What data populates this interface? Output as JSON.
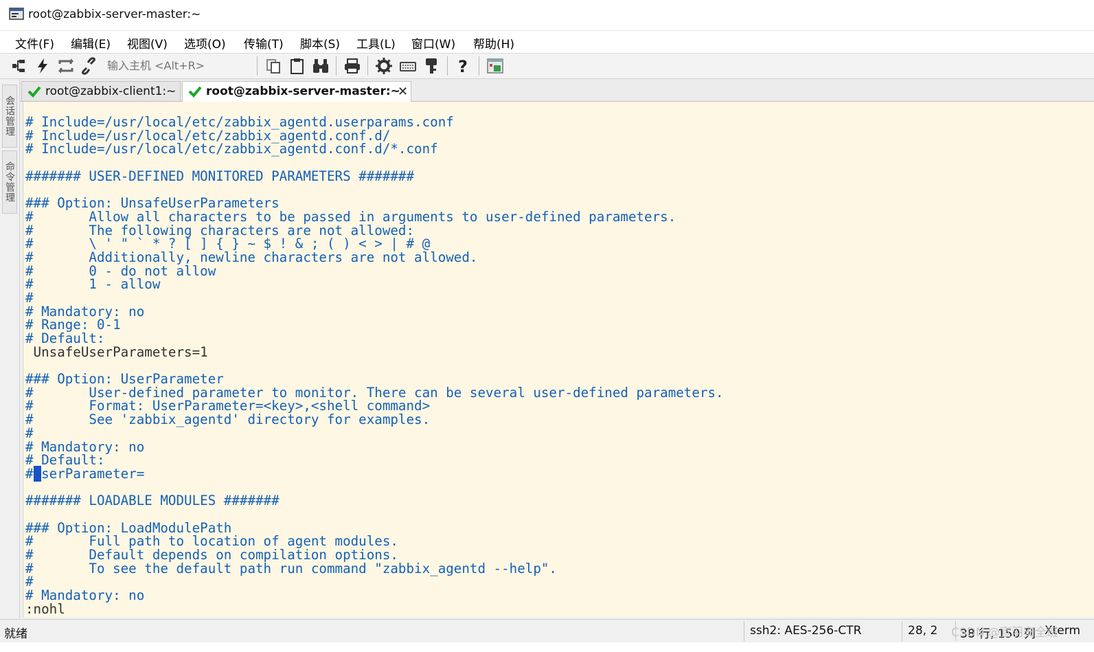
{
  "window": {
    "title": "root@zabbix-server-master:~"
  },
  "menu": [
    {
      "label": "文件(F)"
    },
    {
      "label": "编辑(E)"
    },
    {
      "label": "视图(V)"
    },
    {
      "label": "选项(O)"
    },
    {
      "label": "传输(T)"
    },
    {
      "label": "脚本(S)"
    },
    {
      "label": "工具(L)"
    },
    {
      "label": "窗口(W)"
    },
    {
      "label": "帮助(H)"
    }
  ],
  "toolbar": {
    "host_placeholder": "输入主机 <Alt+R>",
    "icons": [
      "connect-icon",
      "quick-connect-icon",
      "reconnect-icon",
      "disconnect-icon",
      "copy-icon",
      "paste-icon",
      "find-icon",
      "print-icon",
      "settings-icon",
      "keymap-icon",
      "key-icon",
      "help-icon",
      "sftp-icon"
    ]
  },
  "side_tabs": [
    {
      "label": "会话管理"
    },
    {
      "label": "命令管理"
    }
  ],
  "tabs": [
    {
      "label": "root@zabbix-client1:~",
      "active": false
    },
    {
      "label": "root@zabbix-server-master:~",
      "active": true,
      "close": "✕"
    }
  ],
  "terminal": {
    "lines": [
      "# Include=/usr/local/etc/zabbix_agentd.userparams.conf",
      "# Include=/usr/local/etc/zabbix_agentd.conf.d/",
      "# Include=/usr/local/etc/zabbix_agentd.conf.d/*.conf",
      "",
      "####### USER-DEFINED MONITORED PARAMETERS #######",
      "",
      "### Option: UnsafeUserParameters",
      "#       Allow all characters to be passed in arguments to user-defined parameters.",
      "#       The following characters are not allowed:",
      "#       \\ ' \" ` * ? [ ] { } ~ $ ! & ; ( ) < > | # @",
      "#       Additionally, newline characters are not allowed.",
      "#       0 - do not allow",
      "#       1 - allow",
      "#",
      "# Mandatory: no",
      "# Range: 0-1",
      "# Default:",
      " UnsafeUserParameters=1",
      "",
      "### Option: UserParameter",
      "#       User-defined parameter to monitor. There can be several user-defined parameters.",
      "#       Format: UserParameter=<key>,<shell command>",
      "#       See 'zabbix_agentd' directory for examples.",
      "#",
      "# Mandatory: no",
      "# Default:",
      "#",
      "",
      "####### LOADABLE MODULES #######",
      "",
      "### Option: LoadModulePath",
      "#       Full path to location of agent modules.",
      "#       Default depends on compilation options.",
      "#       To see the default path run command \"zabbix_agentd --help\".",
      "#",
      "# Mandatory: no",
      ":nohl"
    ],
    "cursor_line_prefix": "#",
    "cursor_char": "U",
    "cursor_line_rest": "serParameter=",
    "colors": {
      "background": "#fdf7e3",
      "text": "#1560b8",
      "default_text": "#333333",
      "cursor": "#1453c8"
    }
  },
  "status": {
    "ready": "就绪",
    "cipher": "ssh2: AES-256-CTR",
    "position": "28,  2",
    "size": "38 行, 150 列",
    "term": "Xterm",
    "watermark": "CSDN @宣羽安全班"
  }
}
